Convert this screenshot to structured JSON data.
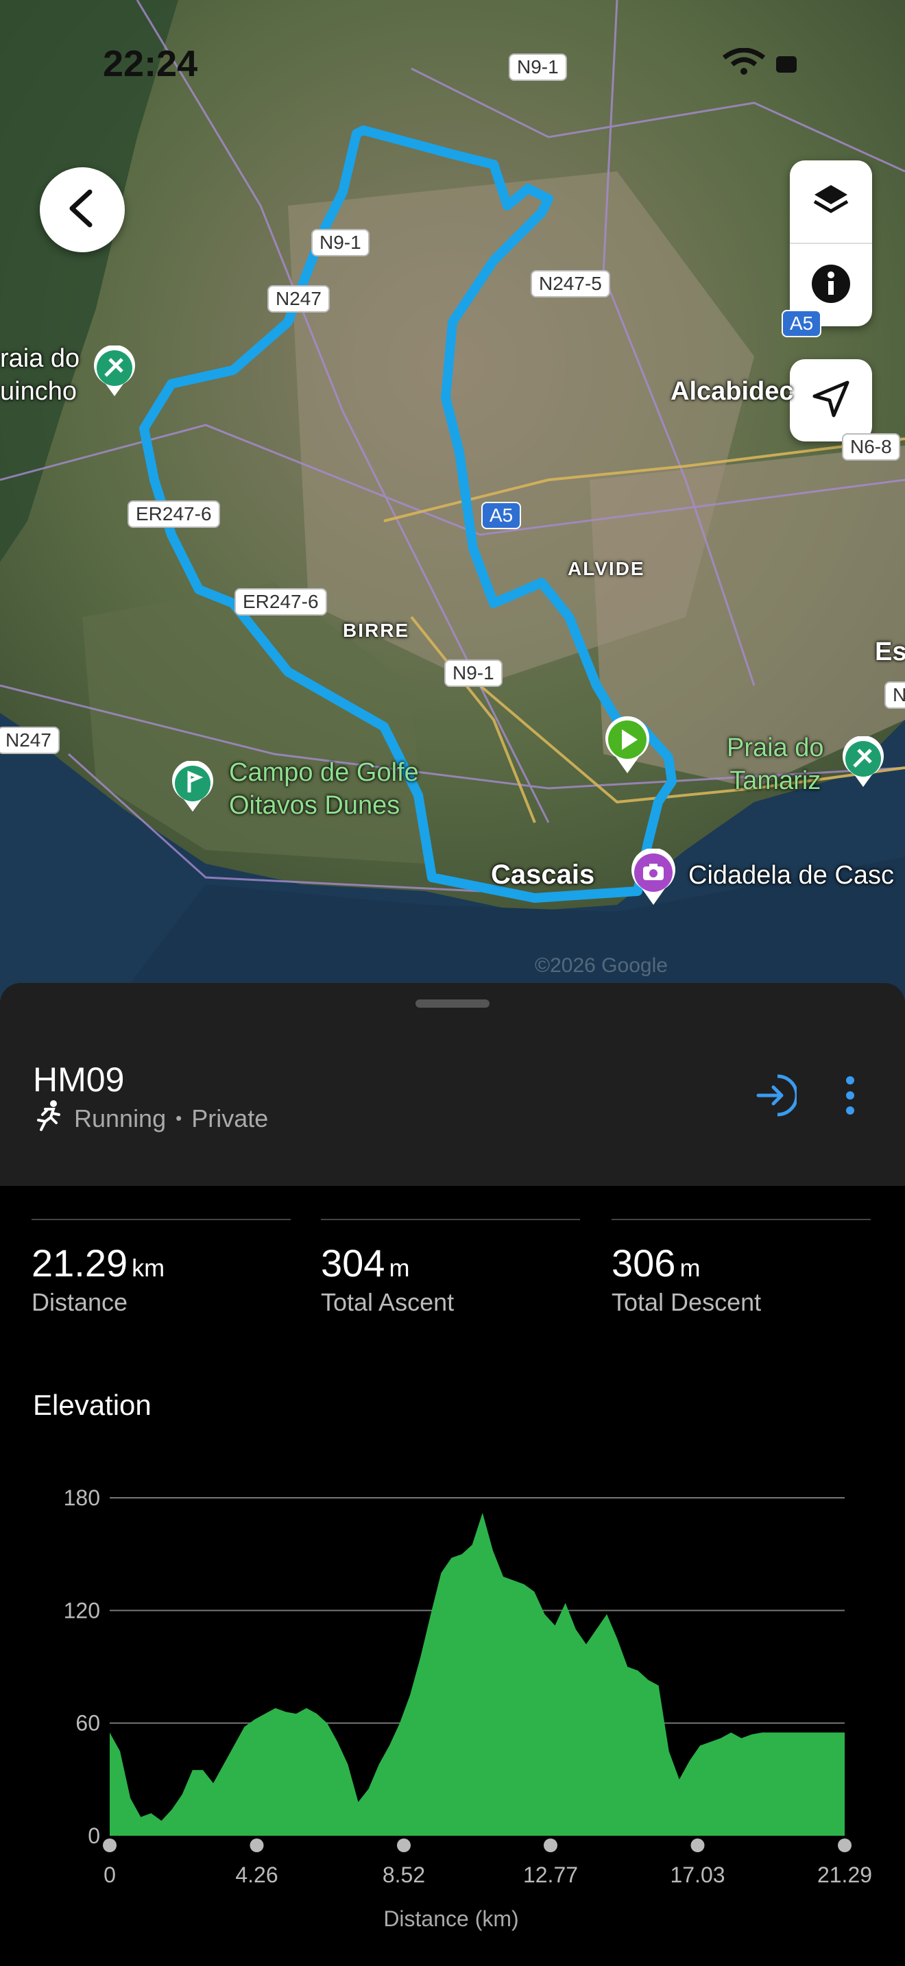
{
  "status_bar": {
    "time": "22:24"
  },
  "map": {
    "roads": [
      "N9-1",
      "N9-1",
      "N247",
      "N247-5",
      "A5",
      "ER247-6",
      "ER247-6",
      "N9-1",
      "N247",
      "N6-8",
      "A5",
      "N"
    ],
    "places": {
      "praia_guincho": "raia do\nuincho",
      "alcabideche": "Alcabidec",
      "alvide": "ALVIDE",
      "birre": "BIRRE",
      "golf": "Campo de Golfe\nOitavos Dunes",
      "tamariz": "Praia do\nTamariz",
      "cascais": "Cascais",
      "cidadela": "Cidadela de Casc",
      "es": "Es",
      "watermark": "©2026 Google"
    },
    "icons": [
      "back-arrow-icon",
      "layers-icon",
      "info-icon",
      "navigation-arrow-icon",
      "start-flag-icon",
      "camera-icon"
    ]
  },
  "activity": {
    "title": "HM09",
    "type": "Running",
    "privacy": "Private",
    "separator": "•"
  },
  "stats": [
    {
      "value": "21.29",
      "unit": "km",
      "label": "Distance"
    },
    {
      "value": "304",
      "unit": "m",
      "label": "Total Ascent"
    },
    {
      "value": "306",
      "unit": "m",
      "label": "Total Descent"
    }
  ],
  "elevation": {
    "title": "Elevation"
  },
  "chart_data": {
    "type": "area",
    "title": "Elevation",
    "xlabel": "Distance (km)",
    "ylabel": "",
    "xlim": [
      0,
      21.29
    ],
    "ylim": [
      0,
      180
    ],
    "xticks": [
      "0",
      "4.26",
      "8.52",
      "12.77",
      "17.03",
      "21.29"
    ],
    "yticks": [
      "0",
      "60",
      "120",
      "180"
    ],
    "color": "#2db34a",
    "grid": true,
    "x": [
      0,
      0.3,
      0.6,
      0.9,
      1.2,
      1.5,
      1.8,
      2.1,
      2.4,
      2.7,
      3.0,
      3.3,
      3.6,
      3.9,
      4.2,
      4.5,
      4.8,
      5.1,
      5.4,
      5.7,
      6.0,
      6.3,
      6.6,
      6.9,
      7.2,
      7.5,
      7.8,
      8.1,
      8.4,
      8.7,
      9.0,
      9.3,
      9.6,
      9.9,
      10.2,
      10.5,
      10.8,
      11.1,
      11.4,
      11.7,
      12.0,
      12.3,
      12.6,
      12.9,
      13.2,
      13.5,
      13.8,
      14.1,
      14.4,
      14.7,
      15.0,
      15.3,
      15.6,
      15.9,
      16.2,
      16.5,
      16.8,
      17.1,
      17.4,
      17.7,
      18.0,
      18.3,
      18.6,
      18.9,
      19.2,
      19.5,
      19.8,
      20.1,
      20.4,
      20.7,
      21.0,
      21.29
    ],
    "values": [
      55,
      45,
      20,
      10,
      12,
      8,
      14,
      22,
      35,
      35,
      28,
      38,
      48,
      58,
      62,
      65,
      68,
      66,
      65,
      68,
      65,
      60,
      50,
      38,
      18,
      25,
      38,
      48,
      60,
      75,
      95,
      118,
      140,
      148,
      150,
      155,
      172,
      152,
      138,
      136,
      134,
      130,
      118,
      112,
      124,
      110,
      102,
      110,
      118,
      105,
      90,
      88,
      83,
      80,
      45,
      30,
      40,
      48,
      50,
      52,
      55,
      52,
      54,
      55,
      55,
      55,
      55,
      55,
      55,
      55,
      55,
      55
    ]
  }
}
